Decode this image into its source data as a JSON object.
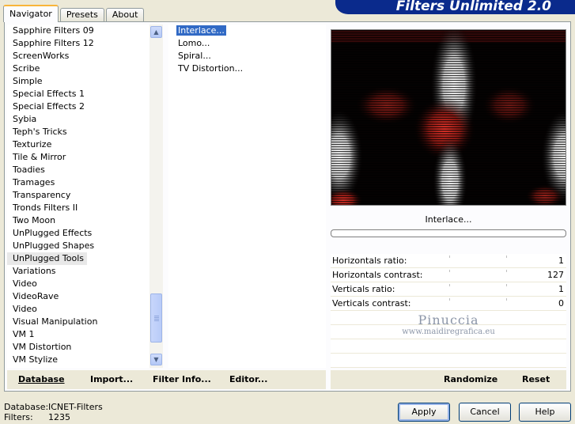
{
  "tabs": [
    {
      "label": "Navigator",
      "active": true
    },
    {
      "label": "Presets",
      "active": false
    },
    {
      "label": "About",
      "active": false
    }
  ],
  "banner_title": "Filters Unlimited 2.0",
  "categories": [
    "Sapphire Filters 09",
    "Sapphire Filters 12",
    "ScreenWorks",
    "Scribe",
    "Simple",
    "Special Effects 1",
    "Special Effects 2",
    "Sybia",
    "Teph's Tricks",
    "Texturize",
    "Tile & Mirror",
    "Toadies",
    "Tramages",
    "Transparency",
    "Tronds Filters II",
    "Two Moon",
    "UnPlugged Effects",
    "UnPlugged Shapes",
    "UnPlugged Tools",
    "Variations",
    "Video",
    "VideoRave",
    "Video",
    "Visual Manipulation",
    "VM 1",
    "VM Distortion",
    "VM Stylize"
  ],
  "selected_category": "UnPlugged Tools",
  "filters": [
    "Interlace...",
    "Lomo...",
    "Spiral...",
    "TV Distortion..."
  ],
  "selected_filter": "Interlace...",
  "filter_name": "Interlace...",
  "params": [
    {
      "label": "Horizontals ratio:",
      "value": "1"
    },
    {
      "label": "Horizontals contrast:",
      "value": "127"
    },
    {
      "label": "Verticals ratio:",
      "value": "1"
    },
    {
      "label": "Verticals contrast:",
      "value": "0"
    }
  ],
  "watermark": {
    "line1": "Pinuccia",
    "line2": "www.maidiregrafica.eu"
  },
  "toolbar": {
    "database": "Database",
    "import": "Import...",
    "filter_info": "Filter Info...",
    "editor": "Editor...",
    "randomize": "Randomize",
    "reset": "Reset"
  },
  "status": {
    "database_label": "Database:",
    "database_value": "ICNET-Filters",
    "filters_label": "Filters:",
    "filters_value": "1235"
  },
  "buttons": {
    "apply": "Apply",
    "cancel": "Cancel",
    "help": "Help"
  },
  "colors": {
    "banner": "#0a2a8c",
    "selection": "#316ac5",
    "preview_red": "#c0392b"
  }
}
